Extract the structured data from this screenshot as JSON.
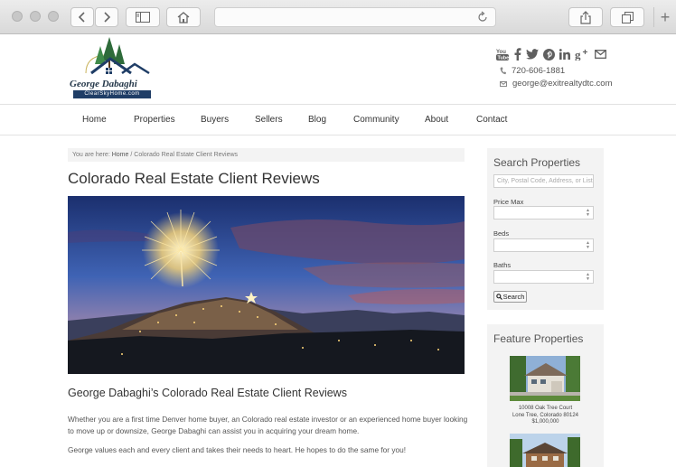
{
  "browser": {
    "address_text": "",
    "newtab_symbol": "+"
  },
  "header": {
    "logo_name": "George Dabaghi",
    "logo_domain": "ClearSkyHome.com",
    "social_icons": [
      "youtube-icon",
      "facebook-icon",
      "twitter-icon",
      "pinterest-icon",
      "linkedin-icon",
      "google-plus-icon",
      "email-icon"
    ],
    "phone": "720-606-1881",
    "email": "george@exitrealtydtc.com"
  },
  "nav": {
    "items": [
      "Home",
      "Properties",
      "Buyers",
      "Sellers",
      "Blog",
      "Community",
      "About",
      "Contact"
    ]
  },
  "breadcrumb": {
    "prefix": "You are here: ",
    "home": "Home",
    "separator": " / ",
    "current": "Colorado Real Estate Client Reviews"
  },
  "content": {
    "title": "Colorado Real Estate Client Reviews",
    "section_title": "George Dabaghi’s Colorado Real Estate Client Reviews",
    "paragraph_1": "Whether you are a first time Denver home buyer, an Colorado real estate investor or an experienced home buyer looking to move up or downsize, George Dabaghi can assist you in acquiring your dream home.",
    "paragraph_2": "George values each and every client and takes their needs to heart. He hopes to do the same for you!"
  },
  "search_widget": {
    "title": "Search Properties",
    "city_placeholder": "City, Postal Code, Address, or Listing #",
    "price_label": "Price Max",
    "beds_label": "Beds",
    "baths_label": "Baths",
    "button_label": "Search"
  },
  "feature_widget": {
    "title": "Feature Properties",
    "properties": [
      {
        "address": "10008 Oak Tree Court",
        "city": "Lone Tree, Colorado 80124",
        "price": "$1,000,000"
      }
    ]
  },
  "colors": {
    "logo_navy": "#1f3d66",
    "logo_green": "#2e6b3a",
    "panel_gray": "#f3f3f3"
  }
}
